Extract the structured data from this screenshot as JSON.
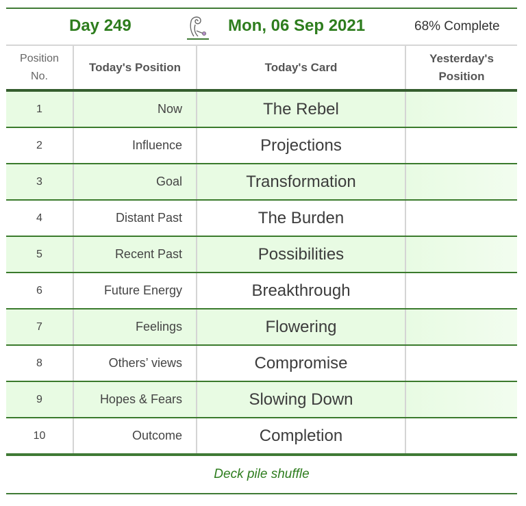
{
  "header": {
    "day_label": "Day 249",
    "date_label": "Mon, 06 Sep 2021",
    "progress_label": "68% Complete",
    "logo_icon": "yoga-figure-logo-icon"
  },
  "table": {
    "columns": [
      "Position No.",
      "Today's Position",
      "Today's Card",
      "Yesterday's Position"
    ],
    "column_lines": {
      "c1a": "Position",
      "c1b": "No.",
      "c4a": "Yesterday's",
      "c4b": "Position"
    },
    "rows": [
      {
        "no": "1",
        "position": "Now",
        "card": "The Rebel",
        "yesterday": ""
      },
      {
        "no": "2",
        "position": "Influence",
        "card": "Projections",
        "yesterday": ""
      },
      {
        "no": "3",
        "position": "Goal",
        "card": "Transformation",
        "yesterday": ""
      },
      {
        "no": "4",
        "position": "Distant Past",
        "card": "The Burden",
        "yesterday": ""
      },
      {
        "no": "5",
        "position": "Recent Past",
        "card": "Possibilities",
        "yesterday": ""
      },
      {
        "no": "6",
        "position": "Future Energy",
        "card": "Breakthrough",
        "yesterday": ""
      },
      {
        "no": "7",
        "position": "Feelings",
        "card": "Flowering",
        "yesterday": ""
      },
      {
        "no": "8",
        "position": "Others’ views",
        "card": "Compromise",
        "yesterday": ""
      },
      {
        "no": "9",
        "position": "Hopes & Fears",
        "card": "Slowing Down",
        "yesterday": ""
      },
      {
        "no": "10",
        "position": "Outcome",
        "card": "Completion",
        "yesterday": ""
      }
    ]
  },
  "footer": {
    "link_label": "Deck pile shuffle"
  },
  "colors": {
    "accent_green": "#2e7d1e",
    "row_highlight": "#e8fbe3"
  }
}
